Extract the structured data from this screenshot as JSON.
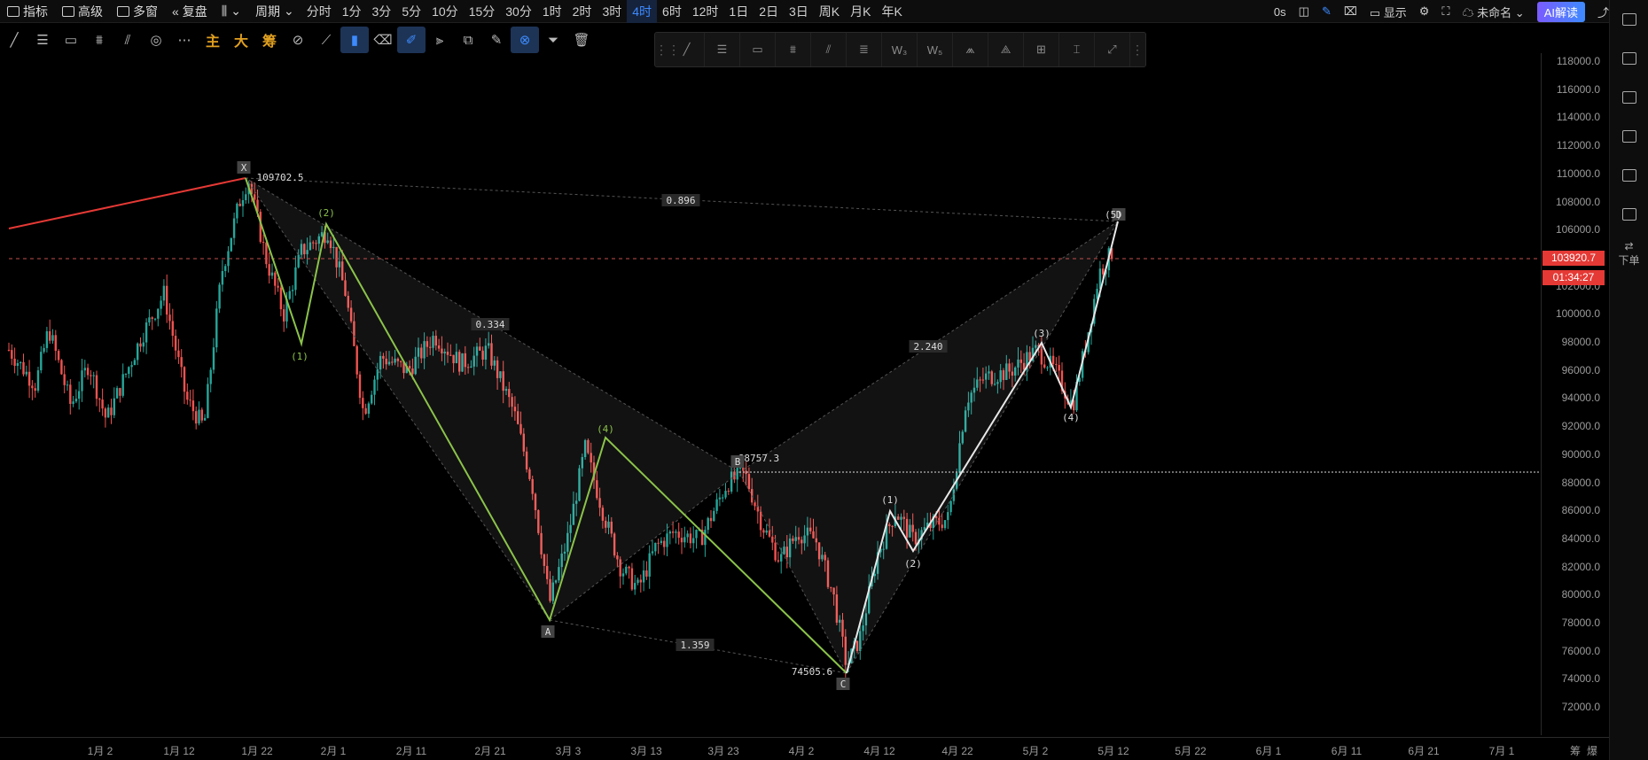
{
  "topbar": {
    "indicator": "指标",
    "advanced": "高级",
    "multi_window": "多窗",
    "replay": "复盘",
    "period": "周期",
    "periods": [
      "分时",
      "1分",
      "3分",
      "5分",
      "10分",
      "15分",
      "30分",
      "1时",
      "2时",
      "3时",
      "4时",
      "6时",
      "12时",
      "1日",
      "2日",
      "3日",
      "周K",
      "月K",
      "年K"
    ],
    "active_period": "4时",
    "latency": "0s",
    "display": "显示",
    "unnamed": "未命名",
    "ai": "AI解读"
  },
  "toolbar": {
    "main": "主",
    "big": "大",
    "chip": "筹"
  },
  "sidebar": {
    "order": "下单"
  },
  "price_axis": [
    "118000.0",
    "116000.0",
    "114000.0",
    "112000.0",
    "110000.0",
    "108000.0",
    "106000.0",
    "104000.0",
    "102000.0",
    "100000.0",
    "98000.0",
    "96000.0",
    "94000.0",
    "92000.0",
    "90000.0",
    "88000.0",
    "86000.0",
    "84000.0",
    "82000.0",
    "80000.0",
    "78000.0",
    "76000.0",
    "74000.0",
    "72000.0"
  ],
  "current_price": "103920.7",
  "countdown": "01:34:27",
  "time_axis": [
    "1月 2",
    "1月 12",
    "1月 22",
    "2月 1",
    "2月 11",
    "2月 21",
    "3月 3",
    "3月 13",
    "3月 23",
    "4月 2",
    "4月 12",
    "4月 22",
    "5月 2",
    "5月 12",
    "5月 22",
    "6月 1",
    "6月 11",
    "6月 21",
    "7月 1"
  ],
  "time_axis_right": [
    "筹",
    "爆"
  ],
  "annotations": {
    "x_price": "109702.5",
    "b_price": "88757.3",
    "c_price": "74505.6",
    "ratio_xd": "0.896",
    "ratio_ab": "0.334",
    "ratio_bd": "2.240",
    "ratio_ac": "1.359",
    "point_x": "X",
    "point_a": "A",
    "point_b": "B",
    "point_c": "C",
    "point_d": "D",
    "w1": "(1)",
    "w2": "(2)",
    "w3": "(3)",
    "w4": "(4)",
    "w5": "(5)"
  },
  "colors": {
    "up": "#26a69a",
    "down": "#ef5350",
    "green_wave": "#8bc34a",
    "white_wave": "#e8e8e8",
    "red_line": "#e53935",
    "accent": "#3d8bff"
  }
}
